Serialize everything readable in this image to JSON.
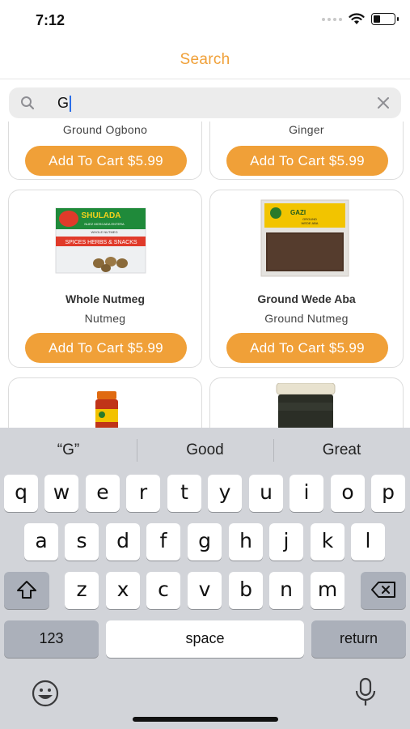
{
  "status_bar": {
    "time": "7:12"
  },
  "header": {
    "title": "Search"
  },
  "search": {
    "query": "G"
  },
  "products": [
    {
      "name": "",
      "category": "Ground Ogbono",
      "button": "Add To Cart $5.99"
    },
    {
      "name": "",
      "category": "Ginger",
      "button": "Add To Cart $5.99"
    },
    {
      "name": "Whole Nutmeg",
      "category": "Nutmeg",
      "button": "Add To Cart $5.99"
    },
    {
      "name": "Ground Wede Aba",
      "category": "Ground Nutmeg",
      "button": "Add To Cart $5.99"
    }
  ],
  "product_images": {
    "whole_nutmeg": {
      "brand": "SHULADA",
      "line1": "NUEZ MOSCADA ENTERA",
      "line2": "WHOLE NUTMEG",
      "banner": "SPICES HERBS & SNACKS"
    },
    "wede_aba": {
      "brand": "GAZI",
      "line1": "GROUND",
      "line2": "WEDE ABA"
    }
  },
  "keyboard": {
    "suggestions": [
      "“G”",
      "Good",
      "Great"
    ],
    "row1": [
      "q",
      "w",
      "e",
      "r",
      "t",
      "y",
      "u",
      "i",
      "o",
      "p"
    ],
    "row2": [
      "a",
      "s",
      "d",
      "f",
      "g",
      "h",
      "j",
      "k",
      "l"
    ],
    "row3": [
      "z",
      "x",
      "c",
      "v",
      "b",
      "n",
      "m"
    ],
    "numbers_key": "123",
    "space_key": "space",
    "return_key": "return"
  },
  "colors": {
    "accent": "#f0a038",
    "keyboard_bg": "#d2d4d9"
  },
  "icons": [
    "search-icon",
    "clear-icon",
    "wifi-icon",
    "battery-icon",
    "shift-icon",
    "backspace-icon",
    "emoji-icon",
    "microphone-icon"
  ]
}
